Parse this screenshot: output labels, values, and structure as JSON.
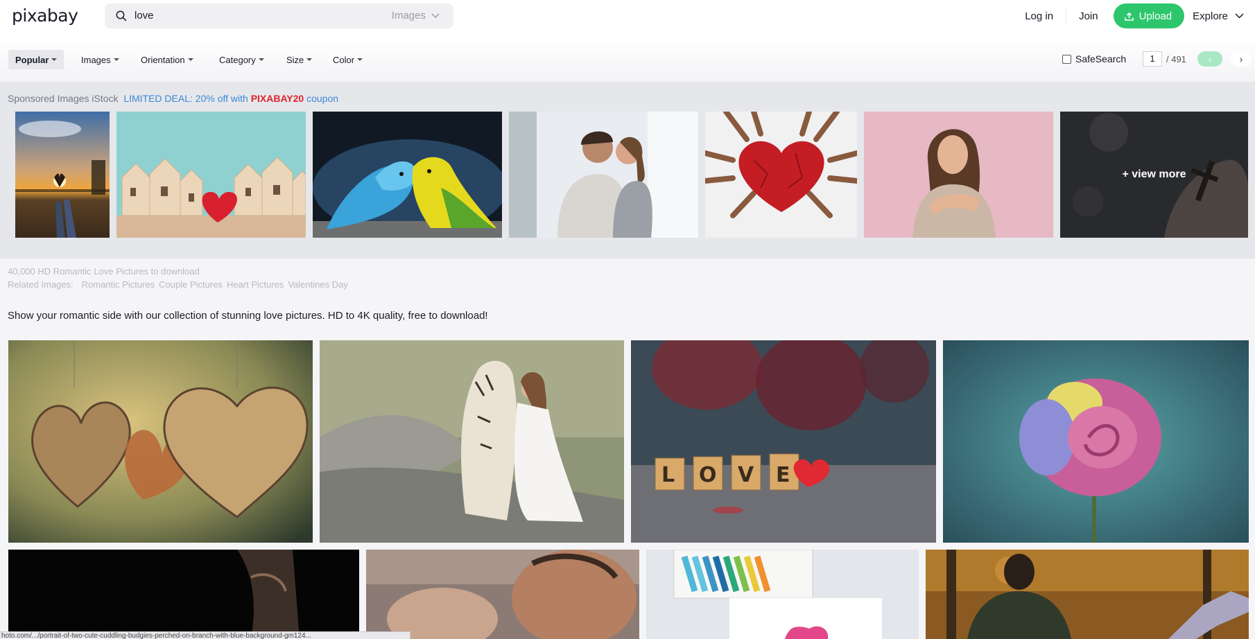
{
  "header": {
    "logo": "pixabay",
    "search_value": "love",
    "search_type": "Images",
    "login": "Log in",
    "join": "Join",
    "upload": "Upload",
    "explore": "Explore"
  },
  "filters": {
    "popular": "Popular",
    "images": "Images",
    "orientation": "Orientation",
    "category": "Category",
    "size": "Size",
    "color": "Color",
    "safesearch": "SafeSearch",
    "page_current": "1",
    "page_total": "/ 491"
  },
  "sponsored": {
    "label": "Sponsored Images iStock",
    "deal_prefix": "LIMITED DEAL: 20% off with",
    "deal_code": "PIXABAY20",
    "deal_suffix": "coupon",
    "view_more": "+ view more"
  },
  "info": {
    "count_line": "40,000 HD Romantic Love Pictures to download",
    "related_label": "Related Images:",
    "related": [
      "Romantic Pictures",
      "Couple Pictures",
      "Heart Pictures",
      "Valentines Day"
    ],
    "description": "Show your romantic side with our collection of stunning love pictures. HD to 4K quality, free to download!"
  },
  "status_url": "hoto.com/.../portrait-of-two-cute-cuddling-budgies-perched-on-branch-with-blue-background-gm124...",
  "colors": {
    "accent": "#2ec66d",
    "deal_link": "#3a87d6",
    "deal_code": "#e0232c"
  }
}
